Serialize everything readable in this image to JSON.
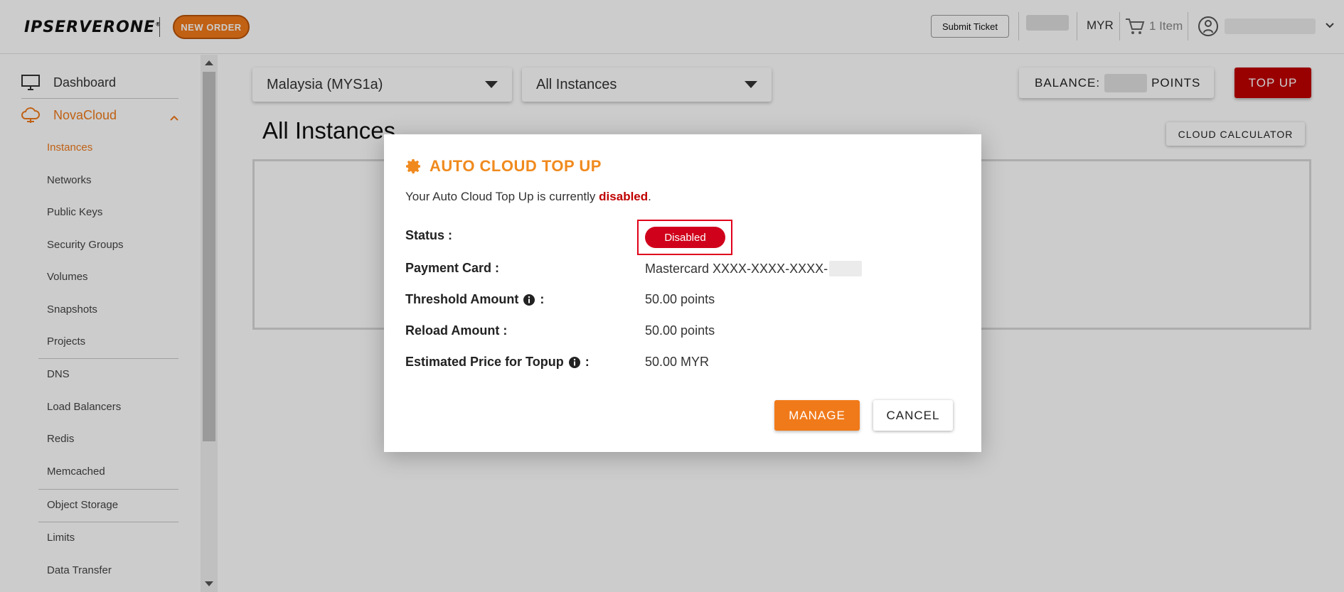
{
  "header": {
    "logo_text": "IPSERVERONE",
    "logo_mark": "®",
    "new_order_label": "NEW ORDER",
    "submit_ticket_label": "Submit Ticket",
    "currency": "MYR",
    "cart_label": "1 Item"
  },
  "sidebar": {
    "dashboard_label": "Dashboard",
    "novacloud_label": "NovaCloud",
    "items": [
      {
        "label": "Instances",
        "active": true
      },
      {
        "label": "Networks"
      },
      {
        "label": "Public Keys"
      },
      {
        "label": "Security Groups"
      },
      {
        "label": "Volumes"
      },
      {
        "label": "Snapshots"
      },
      {
        "label": "Projects"
      },
      {
        "label": "DNS"
      },
      {
        "label": "Load Balancers"
      },
      {
        "label": "Redis"
      },
      {
        "label": "Memcached"
      },
      {
        "label": "Object Storage"
      },
      {
        "label": "Limits"
      },
      {
        "label": "Data Transfer"
      }
    ]
  },
  "main": {
    "region_select": "Malaysia (MYS1a)",
    "instance_filter": "All Instances",
    "balance_prefix": "BALANCE:",
    "balance_suffix": "POINTS",
    "topup_label": "TOP UP",
    "page_title": "All Instances",
    "cloud_calculator_label": "CLOUD CALCULATOR"
  },
  "modal": {
    "title": "AUTO CLOUD TOP UP",
    "desc_prefix": "Your Auto Cloud Top Up is currently ",
    "desc_status": "disabled",
    "desc_suffix": ".",
    "status_label": "Status :",
    "status_value": "Disabled",
    "payment_label": "Payment Card :",
    "payment_value": "Mastercard XXXX-XXXX-XXXX-",
    "threshold_label": "Threshold Amount",
    "threshold_colon": ":",
    "threshold_value": "50.00 points",
    "reload_label": "Reload Amount :",
    "reload_value": "50.00 points",
    "estimate_label": "Estimated Price for Topup",
    "estimate_colon": ":",
    "estimate_value": "50.00 MYR",
    "manage_label": "MANAGE",
    "cancel_label": "CANCEL"
  },
  "colors": {
    "accent_orange": "#f07a1a",
    "danger_red": "#c00000",
    "status_red": "#d0021b"
  }
}
